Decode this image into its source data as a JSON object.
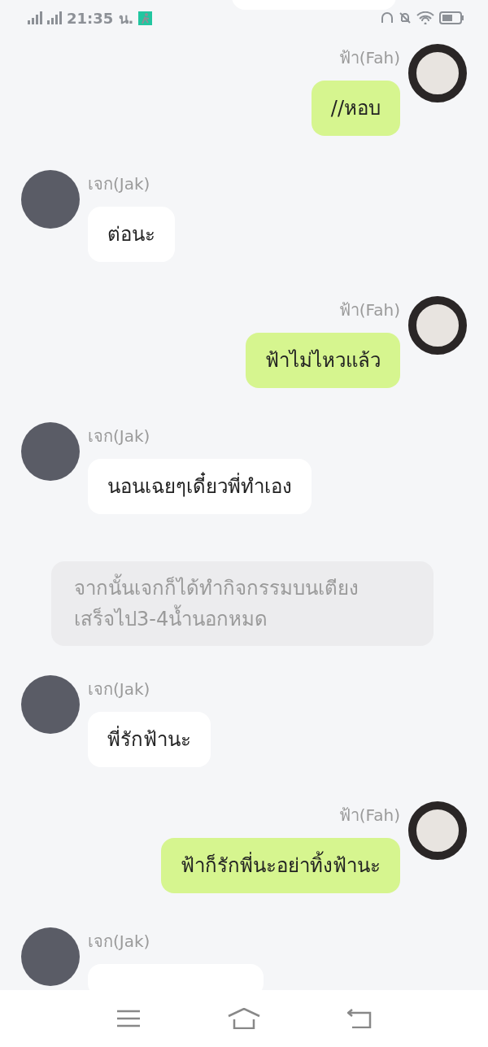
{
  "status_bar": {
    "time": "21:35 น."
  },
  "messages": [
    {
      "kind": "partial"
    },
    {
      "kind": "sent",
      "sender": "ฟ้า(Fah)",
      "text": "//หอบ"
    },
    {
      "kind": "received",
      "sender": "เจก(Jak)",
      "text": "ต่อนะ"
    },
    {
      "kind": "sent",
      "sender": "ฟ้า(Fah)",
      "text": "ฟ้าไม่ไหวแล้ว"
    },
    {
      "kind": "received",
      "sender": "เจก(Jak)",
      "text": "นอนเฉยๆเดี๋ยวพี่ทำเอง"
    },
    {
      "kind": "narration",
      "text": "จากนั้นเจกก็ได้ทำกิจกรรมบนเตียงเสร็จไป3-4น้ำนอกหมด"
    },
    {
      "kind": "received",
      "sender": "เจก(Jak)",
      "text": "พี่รักฟ้านะ"
    },
    {
      "kind": "sent",
      "sender": "ฟ้า(Fah)",
      "text": "ฟ้าก็รักพี่นะอย่าทิ้งฟ้านะ"
    },
    {
      "kind": "received",
      "sender": "เจก(Jak)"
    }
  ]
}
